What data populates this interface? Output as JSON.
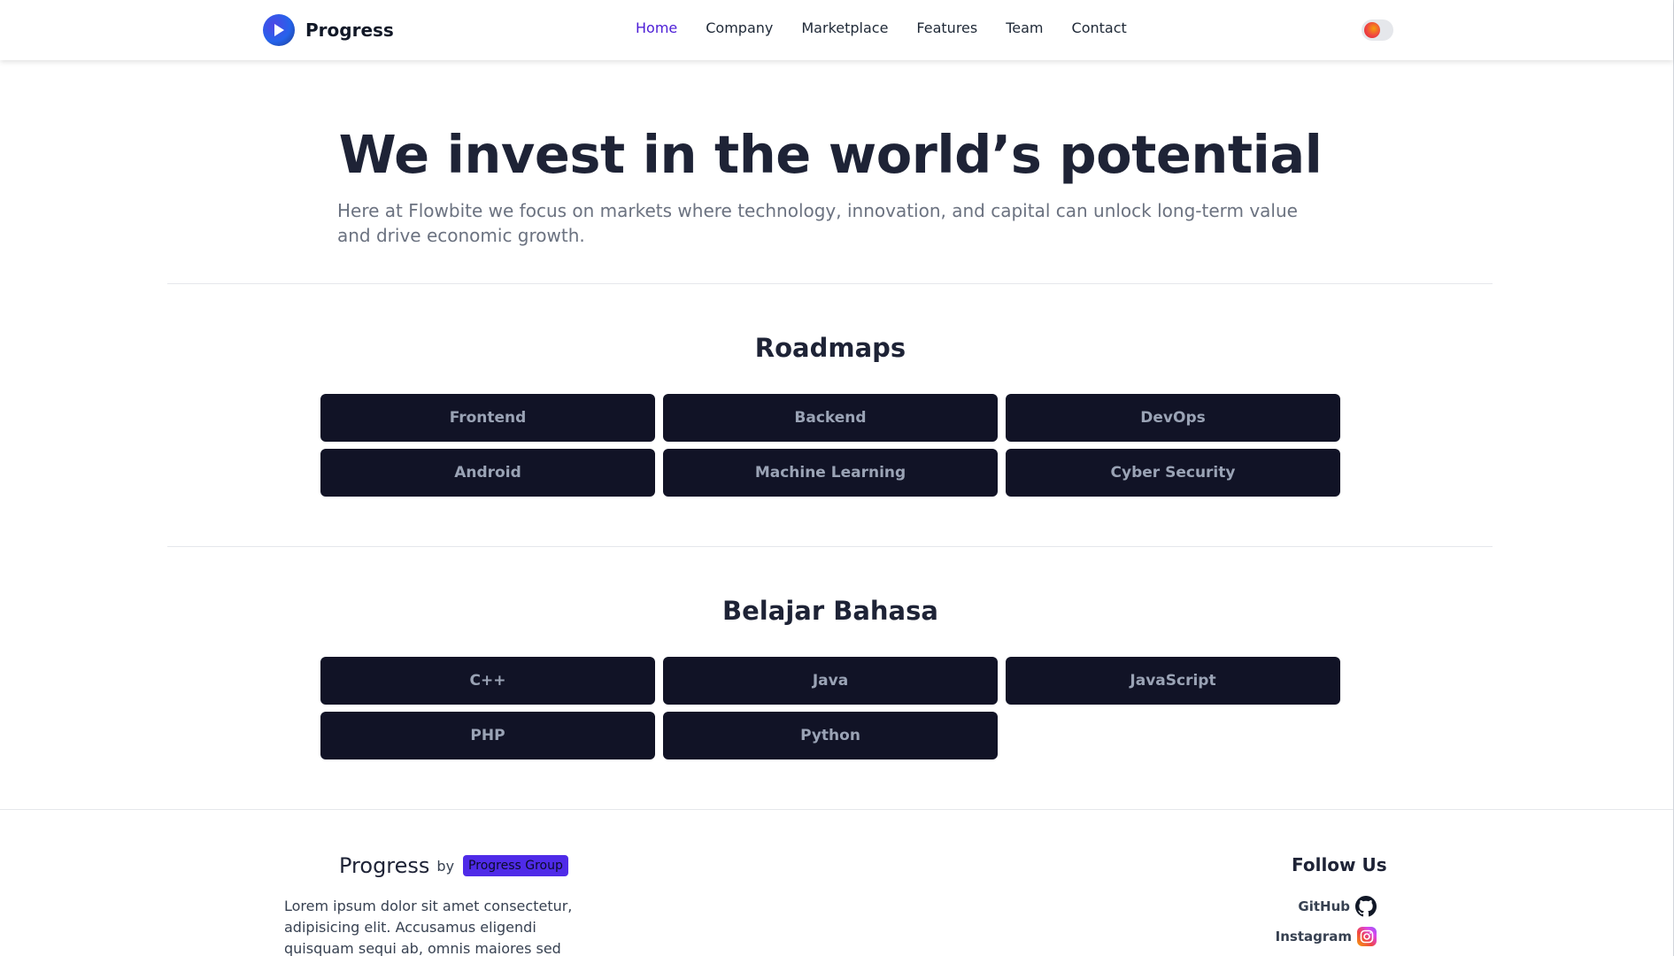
{
  "header": {
    "brand": "Progress",
    "nav": [
      {
        "label": "Home",
        "active": true
      },
      {
        "label": "Company"
      },
      {
        "label": "Marketplace"
      },
      {
        "label": "Features"
      },
      {
        "label": "Team"
      },
      {
        "label": "Contact"
      }
    ],
    "icons": {
      "logo": "play-logo-icon",
      "theme_toggle": "theme-toggle-icon"
    }
  },
  "hero": {
    "title": "We invest in the world’s potential",
    "subtitle": "Here at Flowbite we focus on markets where technology, innovation, and capital can unlock long-term value and drive economic growth."
  },
  "roadmaps": {
    "title": "Roadmaps",
    "items": [
      "Frontend",
      "Backend",
      "DevOps",
      "Android",
      "Machine Learning",
      "Cyber Security"
    ]
  },
  "languages": {
    "title": "Belajar Bahasa",
    "items": [
      "C++",
      "Java",
      "JavaScript",
      "PHP",
      "Python"
    ]
  },
  "footer": {
    "brand": "Progress",
    "by": "by",
    "badge": "Progress Group",
    "text": "Lorem ipsum dolor sit amet consectetur, adipisicing elit. Accusamus eligendi quisquam sequi ab, omnis maiores sed similique odio nemo",
    "follow_title": "Follow Us",
    "social": [
      {
        "label": "GitHub",
        "icon": "github-icon"
      },
      {
        "label": "Instagram",
        "icon": "instagram-icon"
      }
    ]
  },
  "colors": {
    "accent": "#4c1dd6",
    "tile_bg": "#111326",
    "tile_text": "#9aa3b5",
    "badge_bg": "#4f2be8"
  }
}
